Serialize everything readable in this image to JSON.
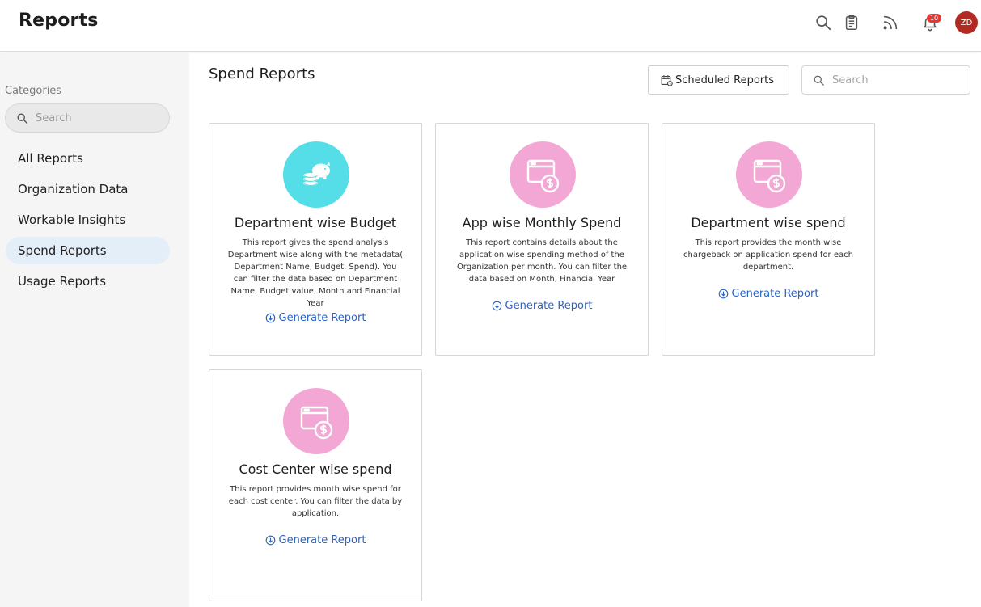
{
  "header": {
    "title": "Reports",
    "notification_count": "10",
    "avatar_initials": "ZD",
    "icons": [
      "search-icon",
      "clipboard-icon",
      "rss-icon",
      "bell-icon"
    ]
  },
  "sidebar": {
    "heading": "Categories",
    "search_placeholder": "Search",
    "items": [
      {
        "label": "All Reports",
        "active": false
      },
      {
        "label": "Organization Data",
        "active": false
      },
      {
        "label": "Workable Insights",
        "active": false
      },
      {
        "label": "Spend Reports",
        "active": true
      },
      {
        "label": "Usage Reports",
        "active": false
      }
    ]
  },
  "main": {
    "title": "Spend Reports",
    "scheduled_button": "Scheduled Reports",
    "search_placeholder": "Search",
    "cards": [
      {
        "title": "Department wise Budget",
        "icon": "piggy-bank-coins-icon",
        "icon_color": "#55dde8",
        "description": "This report gives the spend analysis Department wise along with the metadata( Department Name, Budget, Spend). You can filter the data based on Department Name, Budget value, Month and Financial Year",
        "action": "Generate Report"
      },
      {
        "title": "App wise Monthly Spend",
        "icon": "app-dollar-icon",
        "icon_color": "#f2a7d4",
        "description": "This report contains details about the application wise spending method of the Organization per month. You can filter the data based on Month, Financial Year",
        "action": "Generate Report"
      },
      {
        "title": "Department wise spend",
        "icon": "app-dollar-icon",
        "icon_color": "#f2a7d4",
        "description": "This report provides the month wise chargeback on application spend for each department.",
        "action": "Generate Report"
      },
      {
        "title": "Cost Center wise spend",
        "icon": "app-dollar-icon",
        "icon_color": "#f2a7d4",
        "description": "This report provides month wise spend for each cost center. You can filter the data by application.",
        "action": "Generate Report"
      }
    ]
  }
}
